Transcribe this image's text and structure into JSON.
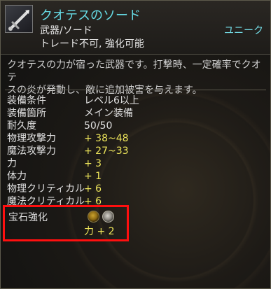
{
  "item": {
    "name": "クオテスのソード",
    "type": "武器/ソード",
    "rarity": "ユニーク",
    "trade_status": "トレード不可, 強化可能",
    "description_line1": "クオテスの力が宿った武器です。打撃時、一定確率でクオテ",
    "description_line2": "スの炎が発動し、敵に追加被害を与えます。",
    "icon": "sword-icon"
  },
  "stats": [
    {
      "label": "装備条件",
      "value": "レベル6以上"
    },
    {
      "label": "装備箇所",
      "value": "メイン装備"
    },
    {
      "label": "耐久度",
      "value": "50/50"
    },
    {
      "label": "物理攻撃力",
      "value": "+ 38~48"
    },
    {
      "label": "魔法攻撃力",
      "value": "+ 27~33"
    },
    {
      "label": "力",
      "value": "+ 3"
    },
    {
      "label": "体力",
      "value": "+ 1"
    },
    {
      "label": "物理クリティカル",
      "value": "+ 6"
    },
    {
      "label": "魔法クリティカル",
      "value": "+ 6"
    }
  ],
  "gem": {
    "label": "宝石強化",
    "bonus": "力 + 2",
    "slots": [
      "gold-gem-icon",
      "silver-gem-icon"
    ]
  },
  "colors": {
    "name": "#66dce6",
    "rarity": "#74dde7",
    "bonus_value": "#ece45a",
    "highlight_box": "#ff0f0f"
  }
}
